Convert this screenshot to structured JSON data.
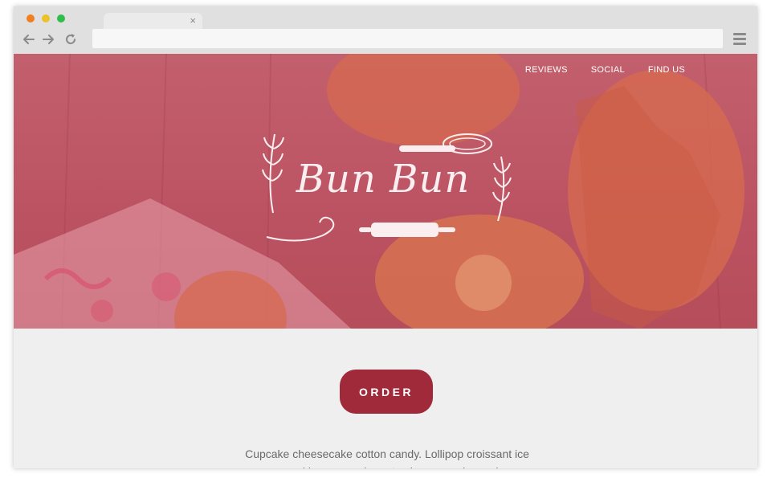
{
  "browser": {
    "tab_close": "×",
    "icons": [
      "back-arrow-icon",
      "forward-arrow-icon",
      "reload-icon",
      "hamburger-menu-icon"
    ]
  },
  "hero": {
    "nav": [
      "REVIEWS",
      "SOCIAL",
      "FIND US"
    ],
    "logo_text": "Bun Bun",
    "overlay_color": "#c0596a"
  },
  "content": {
    "order_label": "ORDER",
    "paragraph": "Cupcake cheesecake cotton candy. Lollipop croissant ice cream gummi bears powder oat cake caramels candy canes sweet roll"
  },
  "colors": {
    "accent": "#a02a39",
    "background": "#efefef"
  }
}
